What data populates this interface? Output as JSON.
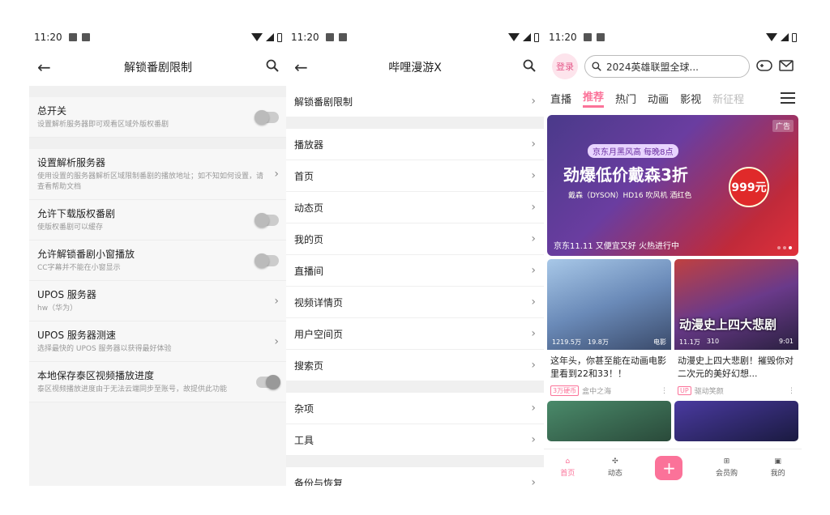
{
  "status": {
    "time": "11:20"
  },
  "p1": {
    "title": "解锁番剧限制",
    "settings": [
      {
        "title": "总开关",
        "sub": "设置解析服务器即可观看区域外版权番剧"
      },
      {
        "title": "设置解析服务器",
        "sub": "使用设置的服务器解析区域限制番剧的播放地址；如不知如何设置，请查看帮助文档"
      },
      {
        "title": "允许下载版权番剧",
        "sub": "使版权番剧可以缓存"
      },
      {
        "title": "允许解锁番剧小窗播放",
        "sub": "CC字幕并不能在小窗显示"
      },
      {
        "title": "UPOS 服务器",
        "sub": "hw（华为）"
      },
      {
        "title": "UPOS 服务器测速",
        "sub": "选择最快的 UPOS 服务器以获得最好体验"
      },
      {
        "title": "本地保存泰区视频播放进度",
        "sub": "泰区视频播放进度由于无法云端同步至账号，故提供此功能"
      }
    ]
  },
  "p2": {
    "title": "哔哩漫游X",
    "items": [
      "解锁番剧限制",
      "播放器",
      "首页",
      "动态页",
      "我的页",
      "直播间",
      "视频详情页",
      "用户空间页",
      "搜索页",
      "杂项",
      "工具",
      "备份与恢复"
    ]
  },
  "p3": {
    "login": "登录",
    "search": "2024英雄联盟全球...",
    "tabs": [
      "直播",
      "推荐",
      "热门",
      "动画",
      "影视",
      "新征程"
    ],
    "banner": {
      "ad": "广告",
      "promo": "京东月黑风高 每晚8点",
      "headline": "劲爆低价戴森3折",
      "sub": "戴森（DYSON）HD16 吹风机 酒红色",
      "price": "999元",
      "slogan": "京东11.11 又便宜又好 火热进行中"
    },
    "cards": [
      {
        "views": "1219.5万",
        "likes": "19.8万",
        "tag": "电影",
        "title": "这年头，你甚至能在动画电影里看到22和33！！",
        "badge": "3万硬币",
        "author": "盒中之海",
        "caption": ""
      },
      {
        "views": "11.1万",
        "likes": "310",
        "tag": "",
        "dur": "9:01",
        "title": "动漫史上四大悲剧！摧毁你对二次元的美好幻想...",
        "badge": "UP",
        "author": "驱动笑颜",
        "caption": "动漫史上四大悲剧"
      }
    ],
    "nav": [
      "首页",
      "动态",
      "",
      "会员购",
      "我的"
    ]
  },
  "colors": {
    "accent": "#fb7299"
  }
}
